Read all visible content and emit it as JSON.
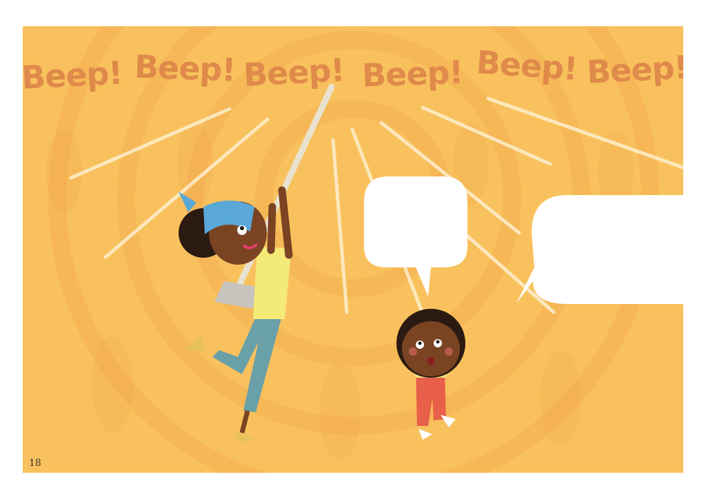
{
  "page": {
    "number": "18",
    "background_color": "#f9c15d",
    "pattern_color": "#f3a64d"
  },
  "beeps": [
    {
      "text": "Beep!"
    },
    {
      "text": "Beep!"
    },
    {
      "text": "Beep!"
    },
    {
      "text": "Beep!"
    },
    {
      "text": "Beep!"
    },
    {
      "text": "Beep!"
    }
  ],
  "colors": {
    "beep_text": "#df8a4a",
    "speech_bubble": "#ffffff",
    "skin": "#7a4322",
    "hair": "#2a1a12",
    "headscarf": "#5aa8d8",
    "top": "#f3ea78",
    "trousers": "#6aa0a8",
    "shoes": "#e6c25a",
    "overalls": "#e8604a",
    "child_shirt": "#f3e07a",
    "broom_handle": "#e8e2cf",
    "broom_head": "#c8c4bd"
  },
  "speech_bubbles": [
    {
      "text": ""
    },
    {
      "text": ""
    }
  ]
}
